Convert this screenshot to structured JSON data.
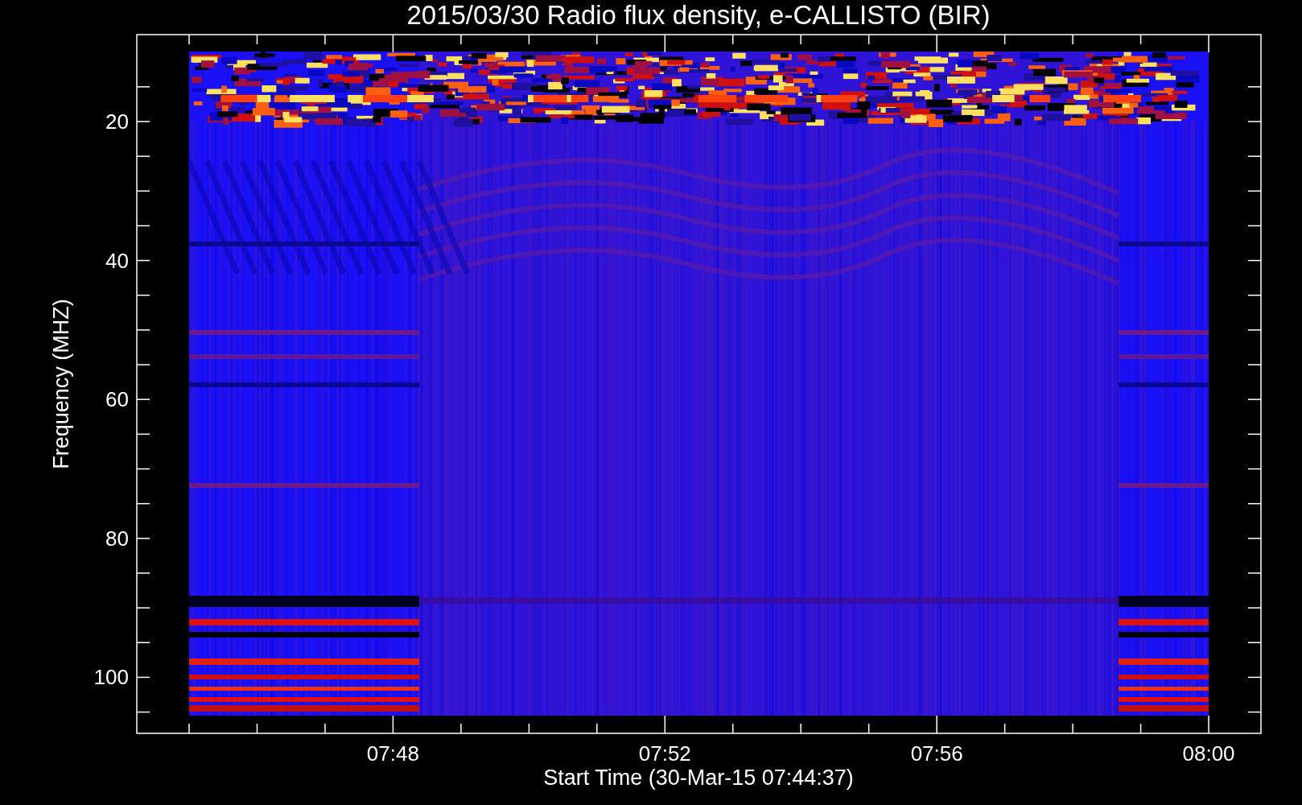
{
  "plot": {
    "title": "2015/03/30  Radio flux density, e-CALLISTO (BIR)",
    "ylabel": "Frequency (MHZ)",
    "xlabel": "Start Time (30-Mar-15 07:44:37)",
    "yticks": [
      "20",
      "40",
      "60",
      "80",
      "100"
    ],
    "xticks": [
      "07:48",
      "07:52",
      "07:56",
      "08:00"
    ]
  }
}
